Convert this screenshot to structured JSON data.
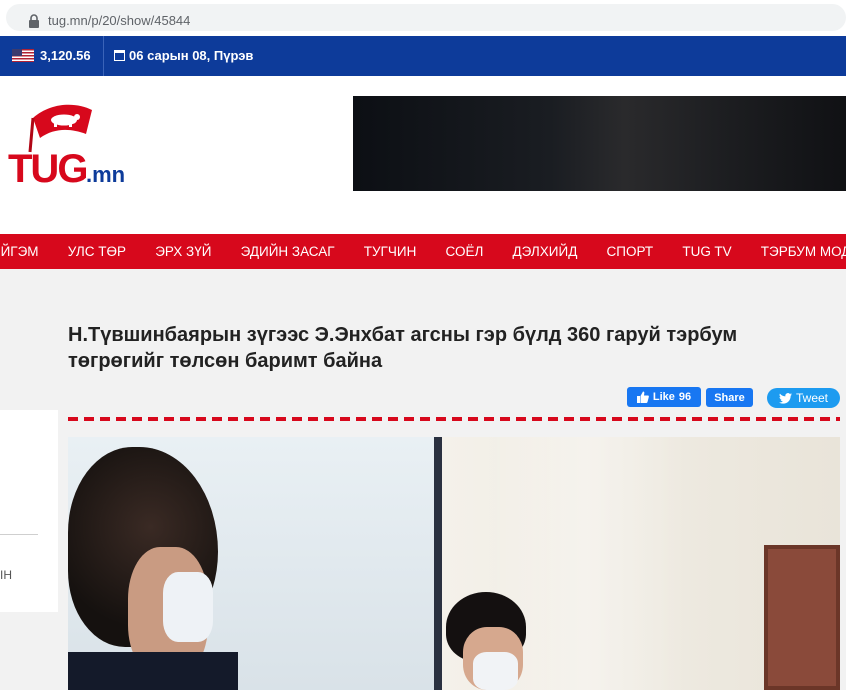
{
  "browser": {
    "url_host": "tug.mn",
    "url_path": "/p/20/show/45844"
  },
  "topbar": {
    "rate": "3,120.56",
    "date": "06 сарын 08, Пүрэв"
  },
  "logo": {
    "text_main": "TUG",
    "text_suffix": ".mn"
  },
  "nav": {
    "items": [
      "ЙГЭМ",
      "УЛС ТӨР",
      "ЭРХ ЗҮЙ",
      "ЭДИЙН ЗАСАГ",
      "ТУГЧИН",
      "СОЁЛ",
      "ДЭЛХИЙД",
      "СПОРТ",
      "TUG TV",
      "ТЭРБУМ МОД"
    ]
  },
  "sidebar": {
    "partial_text": "IН"
  },
  "article": {
    "title": "Н.Түвшинбаярын зүгээс Э.Энхбат агсны гэр бүлд 360 гаруй тэрбум төгрөгийг төлсөн баримт байна"
  },
  "social": {
    "like_label": "Like",
    "like_count": "96",
    "share_label": "Share",
    "tweet_label": "Tweet"
  },
  "colors": {
    "topbar": "#0d3b9a",
    "nav": "#d7081c",
    "accent": "#d7081c",
    "facebook": "#1877f2",
    "twitter": "#1d9bf0"
  }
}
